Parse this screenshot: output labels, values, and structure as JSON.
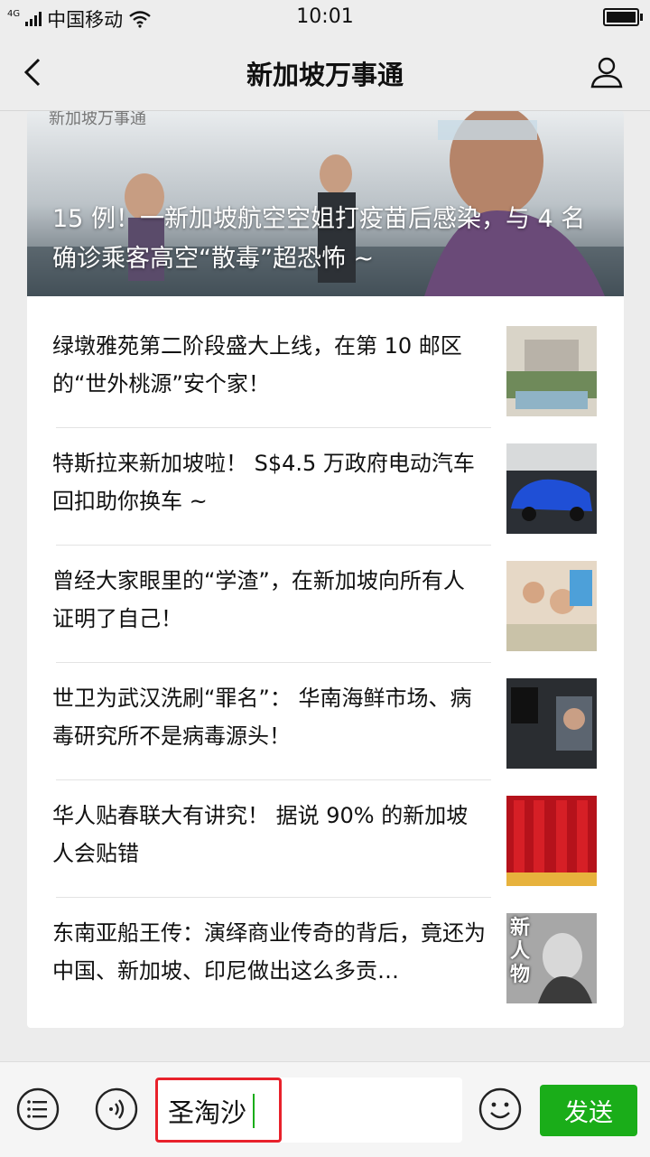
{
  "status": {
    "network_type": "4G",
    "carrier": "中国移动",
    "time": "10:01"
  },
  "nav": {
    "title": "新加坡万事通"
  },
  "cover": {
    "logo_text": "新加坡万事通",
    "title": "15 例！一新加坡航空空姐打疫苗后感染，与 4 名确诊乘客高空“散毒”超恐怖 ~"
  },
  "articles": [
    {
      "title": "绿墩雅苑第二阶段盛大上线，在第 10 邮区的“世外桃源”安个家！",
      "thumb": "residence-image"
    },
    {
      "title": "特斯拉来新加坡啦！ S$4.5 万政府电动汽车回扣助你换车 ~",
      "thumb": "blue-tesla-image"
    },
    {
      "title": "曾经大家眼里的“学渣”，在新加坡向所有人证明了自己！",
      "thumb": "classroom-image"
    },
    {
      "title": "世卫为武汉洗刷“罪名”： 华南海鲜市场、病毒研究所不是病毒源头！",
      "thumb": "car-window-image"
    },
    {
      "title": "华人贴春联大有讲究！ 据说 90% 的新加坡人会贴错",
      "thumb": "spring-couplets-image"
    },
    {
      "title": "东南亚船王传：演绎商业传奇的背后，竟还为中国、新加坡、印尼做出这么多贡…",
      "thumb": "elder-portrait-image",
      "thumb_text": "新人物"
    }
  ],
  "input": {
    "value": "圣淘沙",
    "send_label": "发送"
  },
  "colors": {
    "accent": "#1aad19",
    "highlight": "#e8212b"
  }
}
